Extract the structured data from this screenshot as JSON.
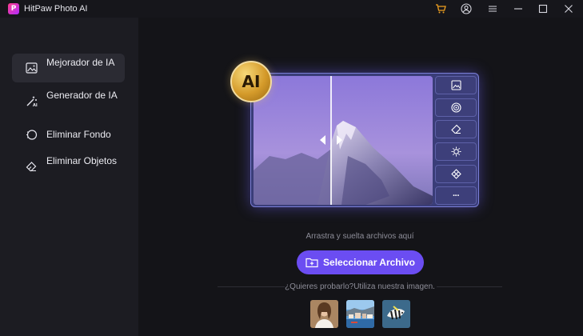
{
  "app": {
    "title": "HitPaw Photo AI",
    "logo_letter": "P"
  },
  "titlebar": {
    "icons": [
      "cart-icon",
      "account-icon",
      "menu-icon",
      "minimize-icon",
      "maximize-icon",
      "close-icon"
    ]
  },
  "sidebar": {
    "items": [
      {
        "label": "Mejorador de IA",
        "icon": "image-enhance-icon",
        "active": true
      },
      {
        "label": "Generador de IA",
        "icon": "magic-wand-icon",
        "active": false
      },
      {
        "label": "Eliminar Fondo",
        "icon": "remove-background-icon",
        "active": false
      },
      {
        "label": "Eliminar Objetos",
        "icon": "eraser-icon",
        "active": false
      }
    ]
  },
  "main": {
    "badge": "AI",
    "tools": [
      "image-icon",
      "circle-pattern-icon",
      "eraser-tool-icon",
      "brightness-icon",
      "restore-icon",
      "more-icon"
    ],
    "more_label": "···",
    "drop_hint": "Arrastra y suelta archivos aquí",
    "select_button": "Seleccionar Archivo",
    "try_text": "¿Quieres probarlo?Utiliza nuestra imagen.",
    "samples": [
      "sample-portrait",
      "sample-coast-town",
      "sample-fish"
    ]
  },
  "colors": {
    "accent": "#6b4df2",
    "background": "#141418",
    "sidebar": "#1c1c22",
    "active_item": "#2b2b33"
  }
}
